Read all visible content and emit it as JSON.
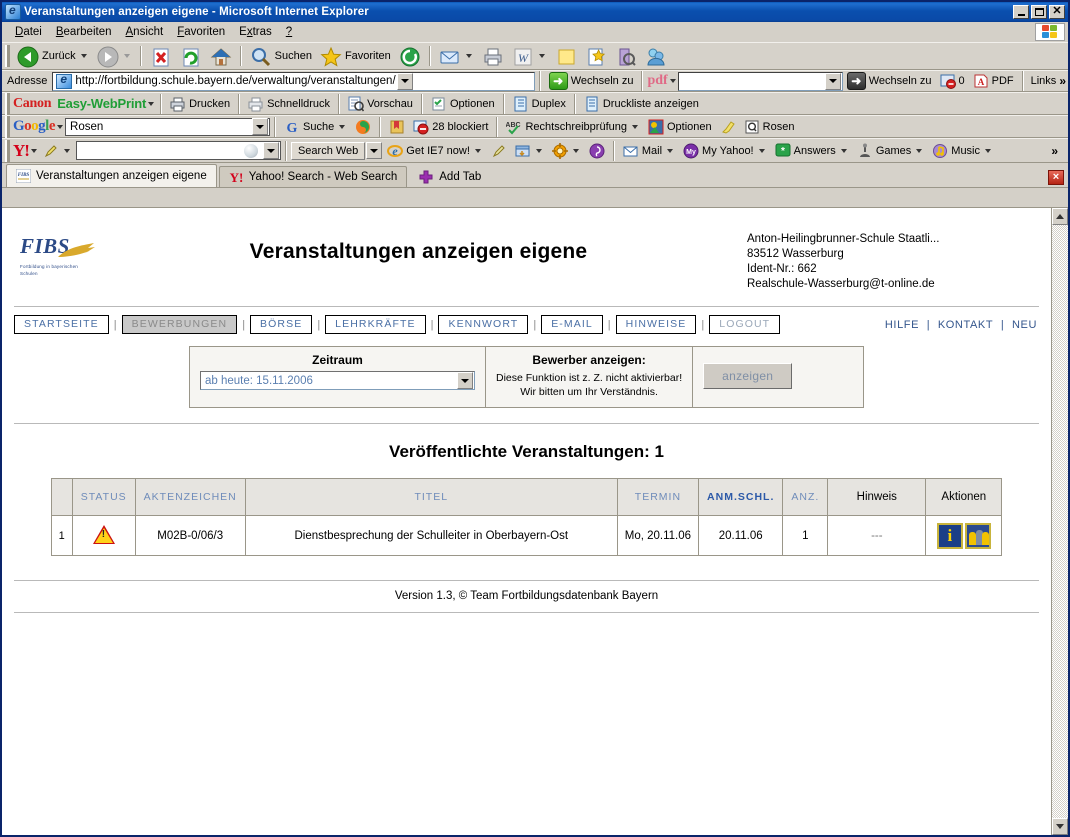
{
  "window": {
    "title": "Veranstaltungen anzeigen eigene - Microsoft Internet Explorer",
    "minimize_label": "Minimieren",
    "maximize_label": "Maximieren",
    "close_label": "Schließen"
  },
  "menu": {
    "items": [
      {
        "label": "Datei",
        "accel": "D"
      },
      {
        "label": "Bearbeiten",
        "accel": "B"
      },
      {
        "label": "Ansicht",
        "accel": "A"
      },
      {
        "label": "Favoriten",
        "accel": "F"
      },
      {
        "label": "Extras",
        "accel": "x"
      },
      {
        "label": "?",
        "accel": "?"
      }
    ]
  },
  "toolbar": {
    "back": "Zurück",
    "forward": "",
    "stop": "",
    "refresh": "",
    "home": "",
    "search": "Suchen",
    "favorites": "Favoriten",
    "history": "",
    "mail": "",
    "print": "",
    "edit": ""
  },
  "address": {
    "label": "Adresse",
    "url": "http://fortbildung.schule.bayern.de/verwaltung/veranstaltungen/",
    "go_label": "Wechseln zu",
    "pdf_label": "pdf",
    "pdf_field_value": "",
    "go2_label": "Wechseln zu",
    "blocked_count": "0",
    "pdf_button": "PDF",
    "links_label": "Links",
    "chevron": "»"
  },
  "canon_bar": {
    "brand": "Canon",
    "product": "Easy-WebPrint",
    "buttons": [
      {
        "label": "Drucken",
        "icon": "printer-icon"
      },
      {
        "label": "Schnelldruck",
        "icon": "quick-print-icon"
      },
      {
        "label": "Vorschau",
        "icon": "preview-icon"
      },
      {
        "label": "Optionen",
        "icon": "options-icon"
      },
      {
        "label": "Duplex",
        "icon": "duplex-icon"
      },
      {
        "label": "Druckliste anzeigen",
        "icon": "print-list-icon"
      }
    ]
  },
  "google_bar": {
    "logo": "Google",
    "search_value": "Rosen",
    "search_placeholder": "",
    "search_button": "Suche",
    "blocked_label": "28 blockiert",
    "spellcheck_label": "Rechtschreibprüfung",
    "options_label": "Optionen",
    "highlight_label": "",
    "term_label": "Rosen"
  },
  "yahoo_bar": {
    "logo": "Y!",
    "search_value": "",
    "search_placeholder": "",
    "search_button": "Search Web",
    "ie7_label": "Get IE7 now!",
    "mail_label": "Mail",
    "myyahoo_label": "My Yahoo!",
    "answers_label": "Answers",
    "games_label": "Games",
    "music_label": "Music",
    "overflow": "»"
  },
  "tabs": {
    "items": [
      {
        "label": "Veranstaltungen anzeigen eigene",
        "icon": "fibs-favicon",
        "active": true
      },
      {
        "label": "Yahoo! Search - Web Search",
        "icon": "yahoo-favicon",
        "active": false
      }
    ],
    "add_tab_label": "Add Tab",
    "close_label": "×"
  },
  "page": {
    "logo_text": "FIBS",
    "logo_sub": "Fortbildung in bayerischen Schulen",
    "title": "Veranstaltungen anzeigen eigene",
    "school_info": [
      "Anton-Heilingbrunner-Schule Staatli...",
      "83512 Wasserburg",
      "Ident-Nr.: 662",
      "Realschule-Wasserburg@t-online.de"
    ],
    "nav": {
      "items": [
        {
          "label": "STARTSEITE",
          "state": "normal"
        },
        {
          "label": "BEWERBUNGEN",
          "state": "active"
        },
        {
          "label": "BÖRSE",
          "state": "normal"
        },
        {
          "label": "LEHRKRÄFTE",
          "state": "normal"
        },
        {
          "label": "KENNWORT",
          "state": "normal"
        },
        {
          "label": "E-MAIL",
          "state": "normal"
        },
        {
          "label": "HINWEISE",
          "state": "normal"
        },
        {
          "label": "LOGOUT",
          "state": "dim"
        }
      ],
      "right_links": [
        "HILFE",
        "KONTAKT",
        "NEU"
      ],
      "separator": "|"
    },
    "filter_panel": {
      "zeitraum_title": "Zeitraum",
      "zeitraum_value": "ab heute: 15.11.2006",
      "bewerber_title": "Bewerber anzeigen:",
      "bewerber_note_1": "Diese Funktion ist z. Z. nicht aktivierbar!",
      "bewerber_note_2": "Wir bitten um Ihr Verständnis.",
      "anzeigen_button": "anzeigen"
    },
    "result_title": "Veröffentlichte Veranstaltungen: 1",
    "table": {
      "headers": [
        "",
        "STATUS",
        "AKTENZEICHEN",
        "TITEL",
        "TERMIN",
        "ANM.SCHL.",
        "ANZ.",
        "Hinweis",
        "Aktionen"
      ],
      "rows": [
        {
          "index": "1",
          "status_icon": "warning-triangle-icon",
          "aktenzeichen": "M02B-0/06/3",
          "titel": "Dienstbesprechung der Schulleiter in Oberbayern-Ost",
          "termin": "Mo, 20.11.06",
          "anm_schl": "20.11.06",
          "anz": "1",
          "hinweis": "---",
          "actions": [
            "info-icon",
            "participants-icon"
          ]
        }
      ]
    },
    "footer": "Version 1.3, © Team Fortbildungsdatenbank Bayern"
  },
  "colors": {
    "title_bar": "#0a4fae",
    "nav_link": "#4a6fa5",
    "accent_blue": "#2c59a8",
    "toolbar_bg": "#d6d2ca",
    "warning_red": "#cc1111",
    "warning_yellow": "#ffd21a"
  }
}
